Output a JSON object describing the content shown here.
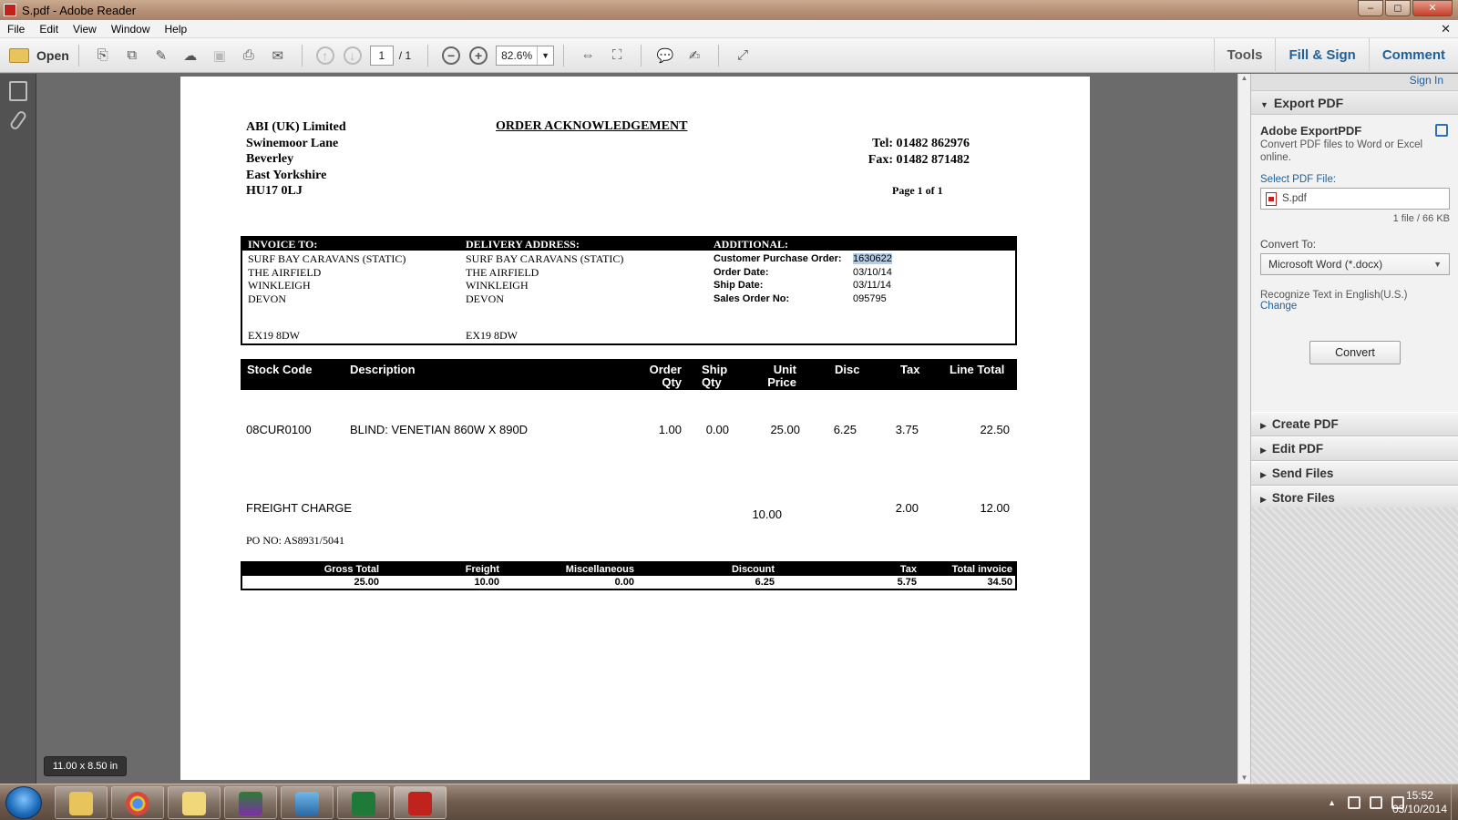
{
  "window": {
    "title": "S.pdf - Adobe Reader",
    "minimize": "–",
    "maximize": "◻",
    "close": "✕"
  },
  "menu": {
    "items": [
      "File",
      "Edit",
      "View",
      "Window",
      "Help"
    ],
    "doc_close": "✕"
  },
  "toolbar": {
    "open_label": "Open",
    "page_current": "1",
    "page_total": "/ 1",
    "zoom": "82.6%",
    "tabs": {
      "tools": "Tools",
      "fill_sign": "Fill & Sign",
      "comment": "Comment"
    }
  },
  "document": {
    "company": [
      "ABI (UK) Limited",
      "Swinemoor Lane",
      "Beverley",
      "East Yorkshire",
      "HU17 0LJ"
    ],
    "title": "ORDER ACKNOWLEDGEMENT",
    "tel": "Tel:   01482 862976",
    "fax": "Fax: 01482 871482",
    "page_of": "Page 1 of 1",
    "invoice_to": {
      "header": "INVOICE TO:",
      "lines": [
        "SURF BAY CARAVANS (STATIC)",
        "THE AIRFIELD",
        "WINKLEIGH",
        "DEVON"
      ],
      "postcode": "EX19 8DW"
    },
    "delivery": {
      "header": "DELIVERY ADDRESS:",
      "lines": [
        "SURF BAY CARAVANS (STATIC)",
        "THE AIRFIELD",
        "WINKLEIGH",
        "DEVON"
      ],
      "postcode": "EX19 8DW"
    },
    "additional": {
      "header": "ADDITIONAL:",
      "labels": [
        "Customer Purchase Order:",
        "Order Date:",
        "Ship Date:",
        "Sales Order No:"
      ],
      "values": [
        "1630622",
        "03/10/14",
        "03/11/14",
        "095795"
      ]
    },
    "columns": {
      "stock_code": "Stock Code",
      "description": "Description",
      "order_qty": [
        "Order",
        "Qty"
      ],
      "ship_qty": [
        "Ship",
        "Qty"
      ],
      "unit_price": [
        "Unit",
        "Price"
      ],
      "disc": "Disc",
      "tax": "Tax",
      "line_total": "Line Total"
    },
    "line1": {
      "stock_code": "08CUR0100",
      "description": "BLIND: VENETIAN 860W X 890D",
      "order_qty": "1.00",
      "ship_qty": "0.00",
      "unit_price": "25.00",
      "disc": "6.25",
      "tax": "3.75",
      "line_total": "22.50"
    },
    "freight_line": {
      "description": "FREIGHT CHARGE",
      "unit_price": "10.00",
      "tax": "2.00",
      "line_total": "12.00"
    },
    "po_no": "PO NO: AS8931/5041",
    "totals": {
      "labels": [
        "Gross Total",
        "Freight",
        "Miscellaneous",
        "Discount",
        "Tax",
        "Total invoice"
      ],
      "values": [
        "25.00",
        "10.00",
        "0.00",
        "6.25",
        "5.75",
        "34.50"
      ]
    }
  },
  "page_size_tooltip": "11.00 x 8.50 in",
  "right_pane": {
    "sign_in": "Sign In",
    "export_title": "Export PDF",
    "service_name": "Adobe ExportPDF",
    "service_desc": "Convert PDF files to Word or Excel online.",
    "select_label": "Select PDF File:",
    "file_name": "S.pdf",
    "file_info": "1 file / 66 KB",
    "convert_to_label": "Convert To:",
    "convert_to_value": "Microsoft Word (*.docx)",
    "recognize": "Recognize Text in English(U.S.)",
    "change": "Change",
    "convert_button": "Convert",
    "sections": [
      "Create PDF",
      "Edit PDF",
      "Send Files",
      "Store Files"
    ]
  },
  "taskbar": {
    "time": "15:52",
    "date": "03/10/2014"
  },
  "colors": {
    "accent_blue": "#1f5f9a",
    "selection": "#b4cbe8",
    "pdf_red": "#c0231b"
  }
}
